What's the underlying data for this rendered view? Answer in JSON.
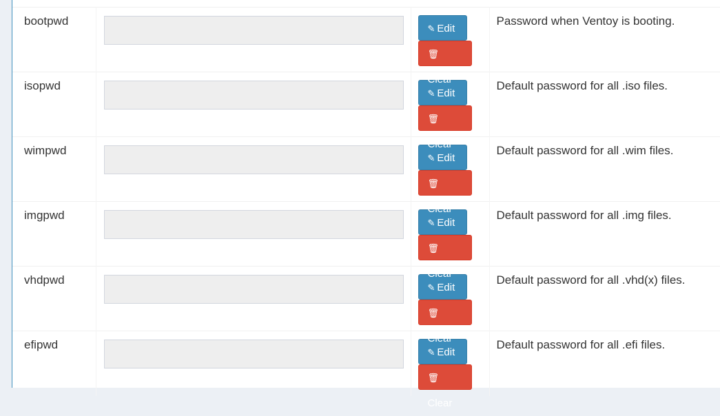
{
  "buttons": {
    "edit": "Edit",
    "clear": "Clear"
  },
  "icons": {
    "edit": "pencil-square-icon",
    "clear": "trash-icon"
  },
  "colors": {
    "edit": "#3c8dbc",
    "clear": "#dd4b39"
  },
  "rows": [
    {
      "key": "bootpwd",
      "value": "",
      "description": "Password when Ventoy is booting."
    },
    {
      "key": "isopwd",
      "value": "",
      "description": "Default password for all .iso files."
    },
    {
      "key": "wimpwd",
      "value": "",
      "description": "Default password for all .wim files."
    },
    {
      "key": "imgpwd",
      "value": "",
      "description": "Default password for all .img files."
    },
    {
      "key": "vhdpwd",
      "value": "",
      "description": "Default password for all .vhd(x) files."
    },
    {
      "key": "efipwd",
      "value": "",
      "description": "Default password for all .efi files."
    }
  ]
}
